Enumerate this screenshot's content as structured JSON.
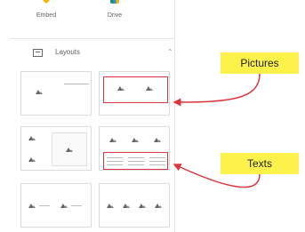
{
  "top_items": [
    {
      "label": "Embed",
      "icon": "embed-icon"
    },
    {
      "label": "Drive",
      "icon": "drive-icon"
    }
  ],
  "section": {
    "title": "Layouts",
    "collapse_icon": "chevron-up-icon"
  },
  "callouts": [
    {
      "label": "Pictures",
      "color": "#fdf24b"
    },
    {
      "label": "Texts",
      "color": "#fdf24b"
    }
  ],
  "colors": {
    "highlight": "#d9363e",
    "callout": "#fdf24b"
  }
}
